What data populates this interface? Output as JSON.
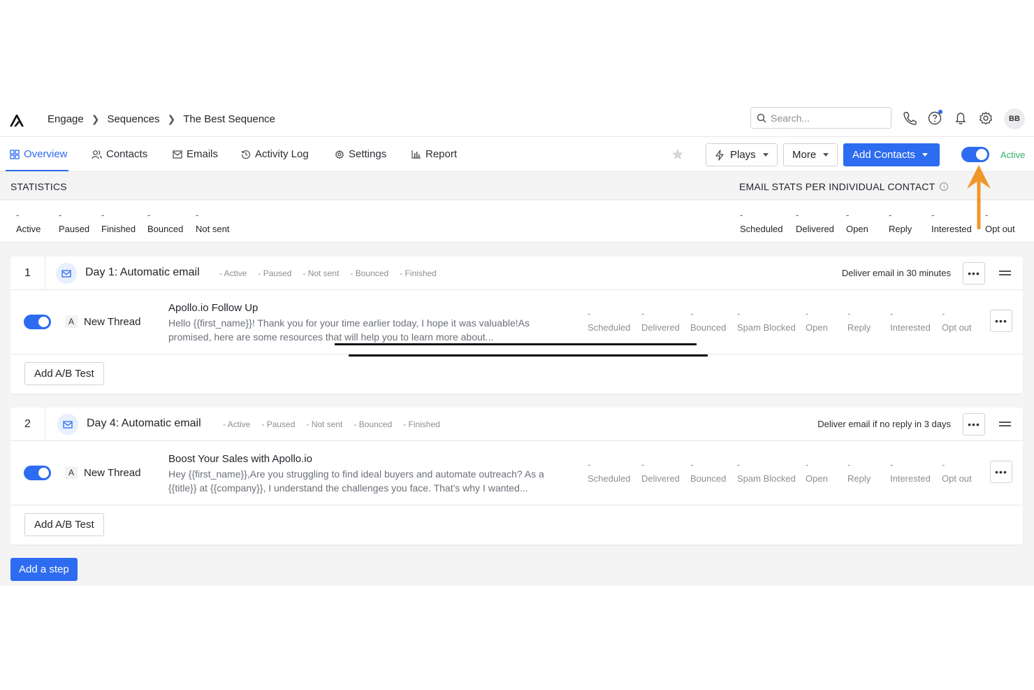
{
  "breadcrumbs": [
    "Engage",
    "Sequences",
    "The Best Sequence"
  ],
  "header": {
    "search_placeholder": "Search...",
    "avatar_initials": "BB"
  },
  "tabs": [
    {
      "label": "Overview",
      "icon": "grid-icon"
    },
    {
      "label": "Contacts",
      "icon": "users-icon"
    },
    {
      "label": "Emails",
      "icon": "mail-icon"
    },
    {
      "label": "Activity Log",
      "icon": "history-icon"
    },
    {
      "label": "Settings",
      "icon": "gear-icon"
    },
    {
      "label": "Report",
      "icon": "chart-icon"
    }
  ],
  "toolbar": {
    "plays_label": "Plays",
    "more_label": "More",
    "add_contacts_label": "Add Contacts",
    "status_label": "Active"
  },
  "statistics": {
    "title": "STATISTICS",
    "email_stats_title": "EMAIL STATS PER INDIVIDUAL CONTACT",
    "info_glyph": "i",
    "left": [
      {
        "label": "Active",
        "value": "-"
      },
      {
        "label": "Paused",
        "value": "-"
      },
      {
        "label": "Finished",
        "value": "-"
      },
      {
        "label": "Bounced",
        "value": "-"
      },
      {
        "label": "Not sent",
        "value": "-"
      }
    ],
    "right": [
      {
        "label": "Scheduled",
        "value": "-"
      },
      {
        "label": "Delivered",
        "value": "-"
      },
      {
        "label": "Open",
        "value": "-"
      },
      {
        "label": "Reply",
        "value": "-"
      },
      {
        "label": "Interested",
        "value": "-"
      },
      {
        "label": "Opt out",
        "value": "-"
      }
    ]
  },
  "steps": [
    {
      "number": "1",
      "title": "Day 1: Automatic email",
      "mini_stats": [
        "- Active",
        "- Paused",
        "- Not sent",
        "- Bounced",
        "- Finished"
      ],
      "deliver_text": "Deliver email in 30 minutes",
      "variant": {
        "letter": "A",
        "thread": "New Thread",
        "subject": "Apollo.io Follow Up",
        "preview": "Hello {{first_name}}! Thank you for your time earlier today, I hope it was valuable!As promised, here are some resources that will help you to learn more about..."
      }
    },
    {
      "number": "2",
      "title": "Day 4: Automatic email",
      "mini_stats": [
        "- Active",
        "- Paused",
        "- Not sent",
        "- Bounced",
        "- Finished"
      ],
      "deliver_text": "Deliver email if no reply in 3 days",
      "variant": {
        "letter": "A",
        "thread": "New Thread",
        "subject": "Boost Your Sales with Apollo.io",
        "preview": "Hey {{first_name}},Are you struggling to find ideal buyers and automate outreach? As a {{title}} at {{company}}, I understand the challenges you face. That's why I wanted..."
      }
    }
  ],
  "variant_stats": [
    {
      "label": "Scheduled",
      "value": "-"
    },
    {
      "label": "Delivered",
      "value": "-"
    },
    {
      "label": "Bounced",
      "value": "-"
    },
    {
      "label": "Spam Blocked",
      "value": "-"
    },
    {
      "label": "Open",
      "value": "-"
    },
    {
      "label": "Reply",
      "value": "-"
    },
    {
      "label": "Interested",
      "value": "-"
    },
    {
      "label": "Opt out",
      "value": "-"
    }
  ],
  "more_glyph": "•••",
  "ab_test_label": "Add A/B Test",
  "add_step_label": "Add a step",
  "colors": {
    "primary": "#2d6cf0",
    "active_green": "#2fb26a",
    "annotation_arrow": "#f0962a"
  }
}
